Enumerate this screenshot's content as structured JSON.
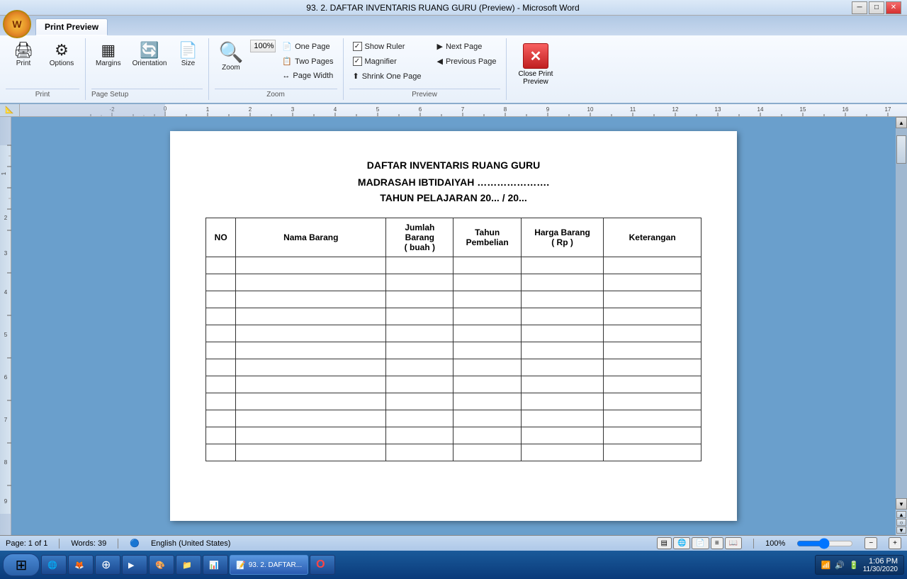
{
  "titlebar": {
    "title": "93. 2. DAFTAR INVENTARIS RUANG GURU (Preview) - Microsoft Word",
    "min": "─",
    "max": "□",
    "close": "✕"
  },
  "ribbon": {
    "tab": "Print Preview",
    "groups": {
      "print": {
        "label": "Print",
        "print_label": "Print",
        "options_label": "Options"
      },
      "page_setup": {
        "label": "Page Setup",
        "margins_label": "Margins",
        "orientation_label": "Orientation",
        "size_label": "Size"
      },
      "zoom": {
        "label": "Zoom",
        "zoom_label": "Zoom",
        "pct": "100%",
        "one_page": "One Page",
        "two_pages": "Two Pages",
        "page_width": "Page Width"
      },
      "preview": {
        "label": "Preview",
        "show_ruler": "Show Ruler",
        "magnifier": "Magnifier",
        "shrink_one_page": "Shrink One Page",
        "next_page": "Next Page",
        "prev_page": "Previous Page"
      },
      "close": {
        "label": "Close Print Preview",
        "btn_label": "Close Print\nPreview"
      }
    }
  },
  "document": {
    "title1": "DAFTAR INVENTARIS RUANG GURU",
    "title2": "MADRASAH IBTIDAIYAH ………………….",
    "title3": "TAHUN PELAJARAN 20... / 20...",
    "table": {
      "headers": [
        "NO",
        "Nama Barang",
        "Jumlah Barang\n( buah )",
        "Tahun\nPembelian",
        "Harga Barang\n( Rp )",
        "Keterangan"
      ],
      "rows": 12
    }
  },
  "statusbar": {
    "page": "Page: 1 of 1",
    "words": "Words: 39",
    "lang": "English (United States)"
  },
  "taskbar": {
    "time": "1:06 PM",
    "date": "11/30/2020",
    "zoom_pct": "100%",
    "apps": [
      "🌐",
      "🦊",
      "⚙",
      "▶",
      "🎨",
      "📁",
      "📊",
      "📝",
      "🔴"
    ]
  },
  "icons": {
    "print": "🖨",
    "options": "⚙",
    "margins": "▦",
    "orientation": "↔",
    "size": "📄",
    "zoom": "🔍",
    "one_page": "📄",
    "two_pages": "📋",
    "page_width": "↔",
    "ruler": "📏",
    "magnifier": "🔍",
    "shrink": "⬆",
    "next": "▶",
    "prev": "◀",
    "close": "✕",
    "windows": "⊞"
  }
}
